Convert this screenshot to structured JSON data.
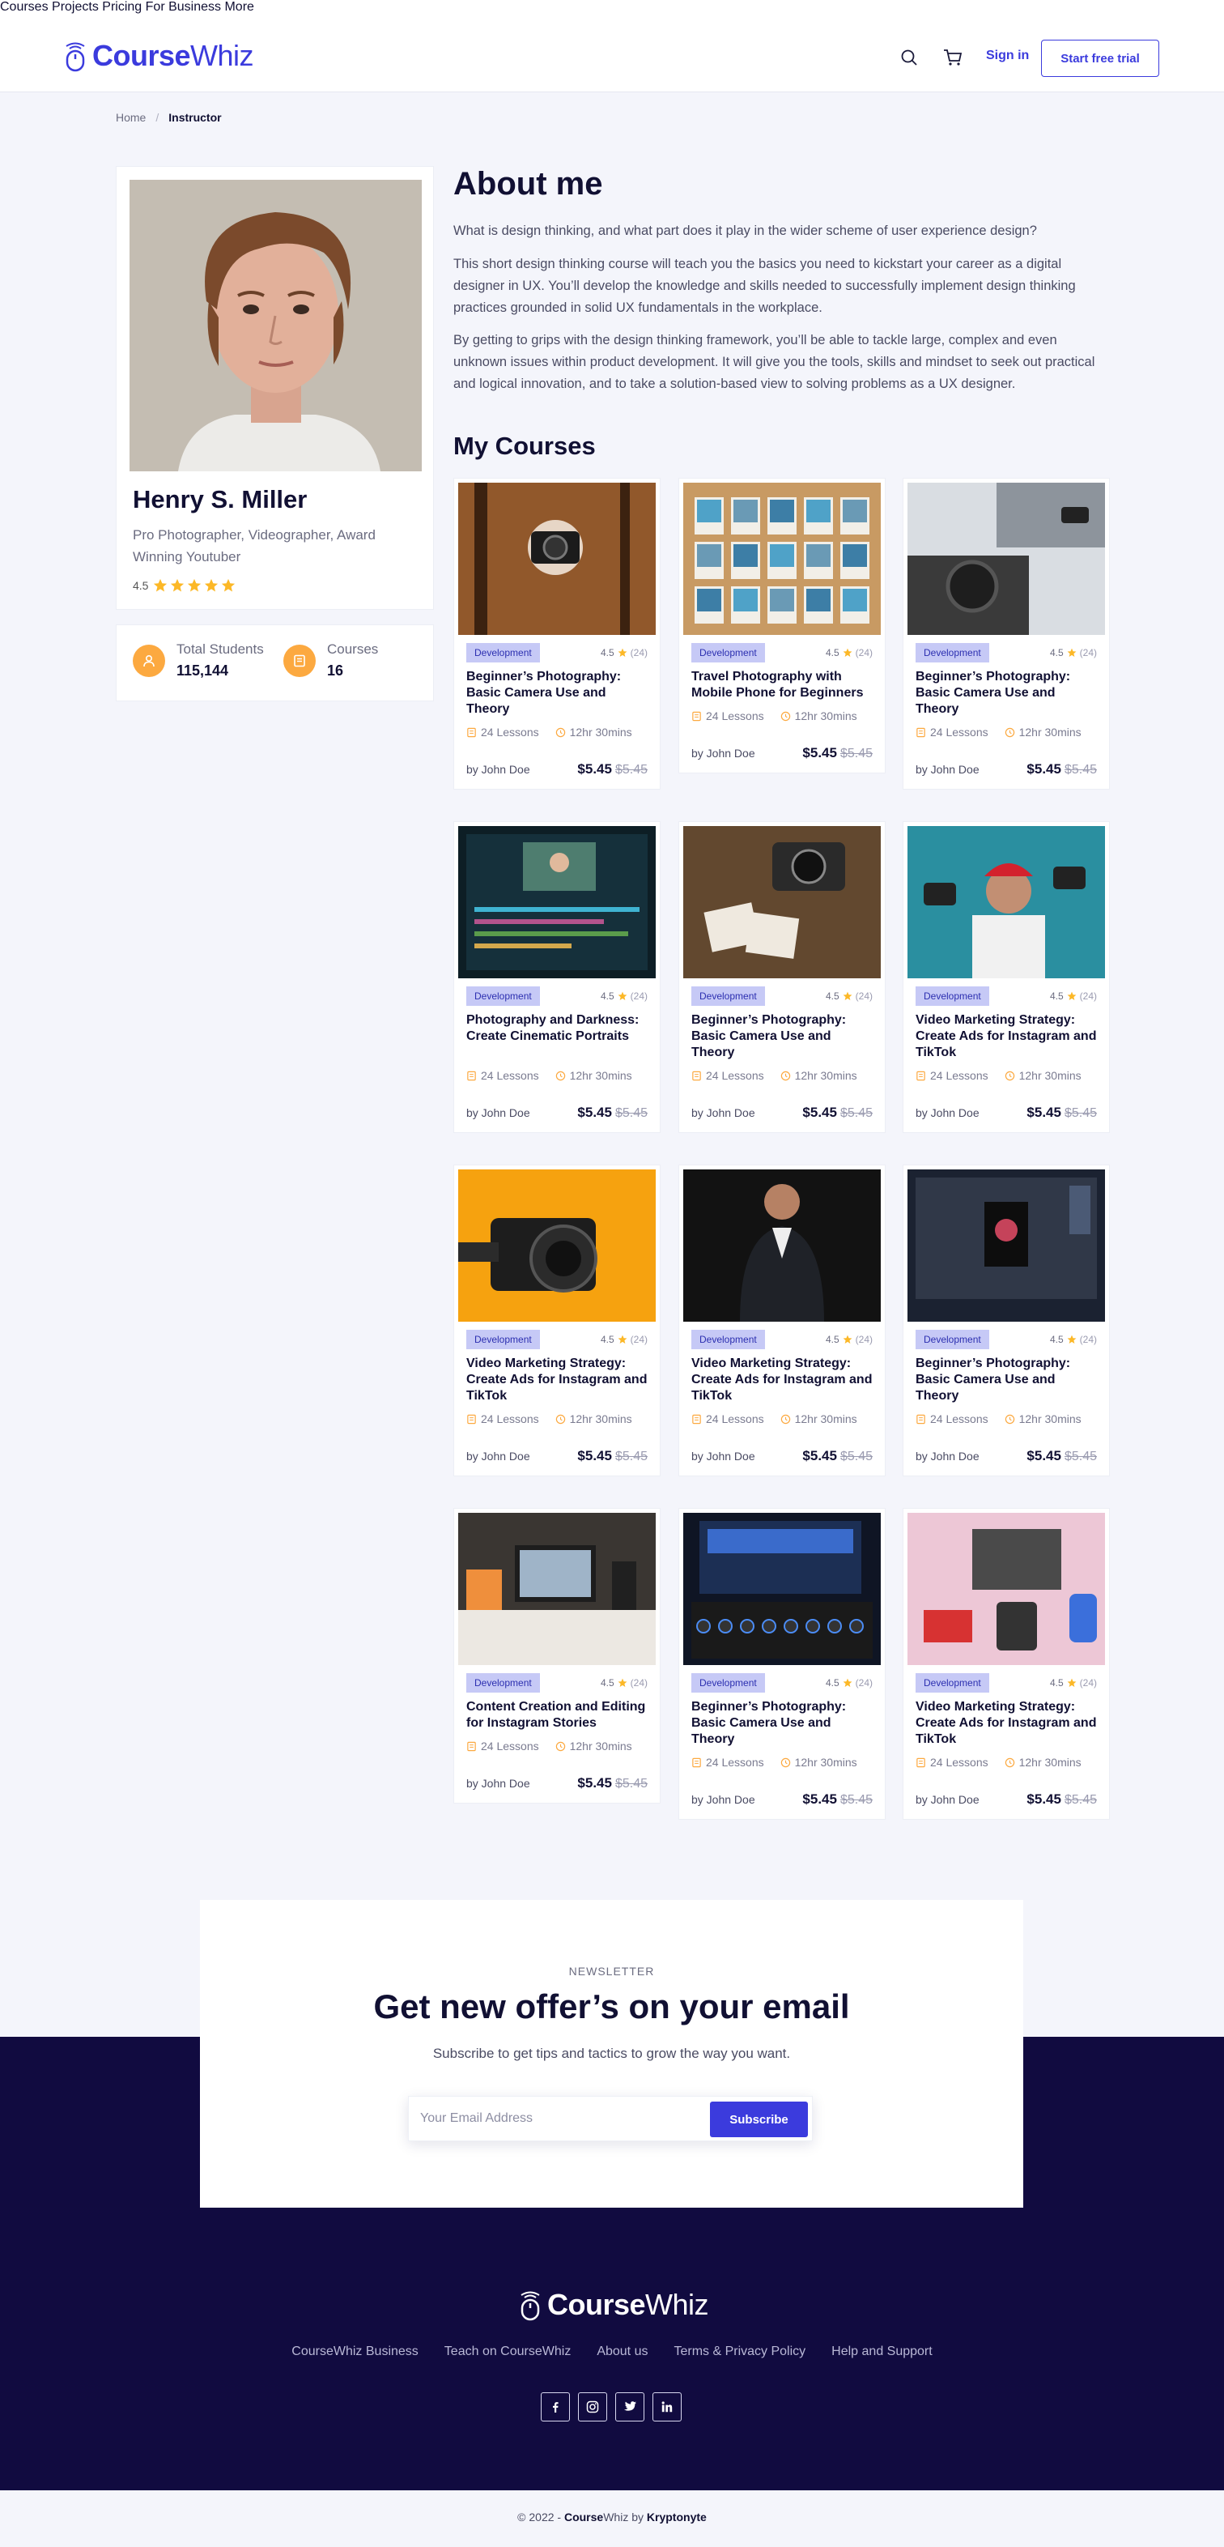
{
  "brand": {
    "bold": "Course",
    "light": "Whiz"
  },
  "nav": {
    "items": [
      "Courses",
      "Projects",
      "Pricing",
      "For Business",
      "More"
    ],
    "signin": "Sign in",
    "trial": "Start free trial"
  },
  "breadcrumb": {
    "home": "Home",
    "current": "Instructor"
  },
  "profile": {
    "name": "Henry S. Miller",
    "role": "Pro Photographer, Videographer, Award Winning Youtuber",
    "rating": "4.5",
    "stats": [
      {
        "label": "Total Students",
        "value": "115,144"
      },
      {
        "label": "Courses",
        "value": "16"
      }
    ]
  },
  "about": {
    "title": "About me",
    "paragraphs": [
      "What is design thinking, and what part does it play in the wider scheme of user experience design?",
      "This short design thinking course will teach you the basics you need to kickstart your career as a digital designer in UX. You’ll develop the knowledge and skills needed to successfully implement design thinking practices grounded in solid UX fundamentals in the workplace.",
      "By getting to grips with the design thinking framework, you’ll be able to tackle large, complex and even unknown issues within product development. It will give you the tools, skills and mindset to seek out practical and logical innovation, and to take a solution-based view to solving problems as a UX designer."
    ]
  },
  "courses_title": "My Courses",
  "courses": [
    {
      "title": "Beginner’s Photography: Basic Camera Use and Theory",
      "tag": "Development",
      "rating": "4.5",
      "count": "(24)",
      "lessons": "24 Lessons",
      "duration": "12hr 30mins",
      "author": "by John Doe",
      "price": "$5.45",
      "old": "$5.45"
    },
    {
      "title": "Travel Photography with Mobile Phone for Beginners",
      "tag": "Development",
      "rating": "4.5",
      "count": "(24)",
      "lessons": "24 Lessons",
      "duration": "12hr 30mins",
      "author": "by John Doe",
      "price": "$5.45",
      "old": "$5.45"
    },
    {
      "title": "Beginner’s Photography: Basic Camera Use and Theory",
      "tag": "Development",
      "rating": "4.5",
      "count": "(24)",
      "lessons": "24 Lessons",
      "duration": "12hr 30mins",
      "author": "by John Doe",
      "price": "$5.45",
      "old": "$5.45"
    },
    {
      "title": "Photography and Darkness: Create Cinematic Portraits",
      "tag": "Development",
      "rating": "4.5",
      "count": "(24)",
      "lessons": "24 Lessons",
      "duration": "12hr 30mins",
      "author": "by John Doe",
      "price": "$5.45",
      "old": "$5.45"
    },
    {
      "title": "Beginner’s Photography: Basic Camera Use and Theory",
      "tag": "Development",
      "rating": "4.5",
      "count": "(24)",
      "lessons": "24 Lessons",
      "duration": "12hr 30mins",
      "author": "by John Doe",
      "price": "$5.45",
      "old": "$5.45"
    },
    {
      "title": "Video Marketing Strategy: Create Ads for Instagram and TikTok",
      "tag": "Development",
      "rating": "4.5",
      "count": "(24)",
      "lessons": "24 Lessons",
      "duration": "12hr 30mins",
      "author": "by John Doe",
      "price": "$5.45",
      "old": "$5.45"
    },
    {
      "title": "Video Marketing Strategy: Create Ads for Instagram and TikTok",
      "tag": "Development",
      "rating": "4.5",
      "count": "(24)",
      "lessons": "24 Lessons",
      "duration": "12hr 30mins",
      "author": "by John Doe",
      "price": "$5.45",
      "old": "$5.45"
    },
    {
      "title": "Video Marketing Strategy: Create Ads for Instagram and TikTok",
      "tag": "Development",
      "rating": "4.5",
      "count": "(24)",
      "lessons": "24 Lessons",
      "duration": "12hr 30mins",
      "author": "by John Doe",
      "price": "$5.45",
      "old": "$5.45"
    },
    {
      "title": "Beginner’s Photography: Basic Camera Use and Theory",
      "tag": "Development",
      "rating": "4.5",
      "count": "(24)",
      "lessons": "24 Lessons",
      "duration": "12hr 30mins",
      "author": "by John Doe",
      "price": "$5.45",
      "old": "$5.45"
    },
    {
      "title": "Content Creation and Editing for Instagram Stories",
      "tag": "Development",
      "rating": "4.5",
      "count": "(24)",
      "lessons": "24 Lessons",
      "duration": "12hr 30mins",
      "author": "by John Doe",
      "price": "$5.45",
      "old": "$5.45"
    },
    {
      "title": "Beginner’s Photography: Basic Camera Use and Theory",
      "tag": "Development",
      "rating": "4.5",
      "count": "(24)",
      "lessons": "24 Lessons",
      "duration": "12hr 30mins",
      "author": "by John Doe",
      "price": "$5.45",
      "old": "$5.45"
    },
    {
      "title": "Video Marketing Strategy: Create Ads for Instagram and TikTok",
      "tag": "Development",
      "rating": "4.5",
      "count": "(24)",
      "lessons": "24 Lessons",
      "duration": "12hr 30mins",
      "author": "by John Doe",
      "price": "$5.45",
      "old": "$5.45"
    }
  ],
  "newsletter": {
    "eyebrow": "NEWSLETTER",
    "title": "Get new offer’s on your email",
    "subtitle": "Subscribe to get tips and tactics to grow the way you want.",
    "placeholder": "Your Email Address",
    "button": "Subscribe"
  },
  "footer": {
    "links": [
      "CourseWhiz Business",
      "Teach on CourseWhiz",
      "About us",
      "Terms & Privacy Policy",
      "Help and Support"
    ],
    "socials": [
      "facebook-icon",
      "instagram-icon",
      "twitter-icon",
      "linkedin-icon"
    ],
    "copyright_prefix": "© 2022 - ",
    "copyright_brand_bold": "Course",
    "copyright_brand_light": "Whiz",
    "copyright_by": " by ",
    "copyright_company": "Kryptonyte"
  },
  "colors": {
    "primary": "#3b3bdd",
    "dark": "#110b40",
    "accent": "#fca940",
    "tag_bg": "#c6c9f6"
  }
}
